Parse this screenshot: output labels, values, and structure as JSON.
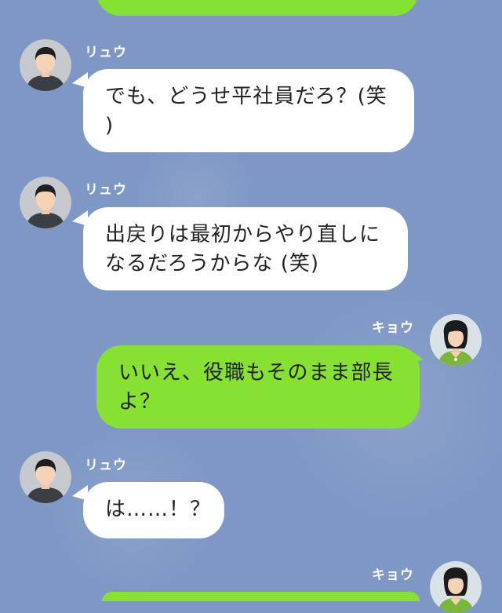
{
  "colors": {
    "background": "#7e97c5",
    "incoming_bubble": "#ffffff",
    "outgoing_bubble": "#86e131",
    "name_text": "#ffffff"
  },
  "messages": [
    {
      "sender": "リュウ",
      "side": "left",
      "lines": [
        "でも、どうせ平社員だろ？(笑",
        ")"
      ]
    },
    {
      "sender": "リュウ",
      "side": "left",
      "lines": [
        "出戻りは最初からやり直しに",
        "なるだろうからな (笑)"
      ]
    },
    {
      "sender": "キョウ",
      "side": "right",
      "lines": [
        "いいえ、役職もそのまま部長",
        "よ？"
      ]
    },
    {
      "sender": "リュウ",
      "side": "left",
      "lines": [
        "は……！？"
      ]
    },
    {
      "sender": "キョウ",
      "side": "right",
      "lines": []
    }
  ],
  "icons": {
    "ryu_avatar": "man-avatar-icon",
    "kyo_avatar": "woman-avatar-icon"
  }
}
